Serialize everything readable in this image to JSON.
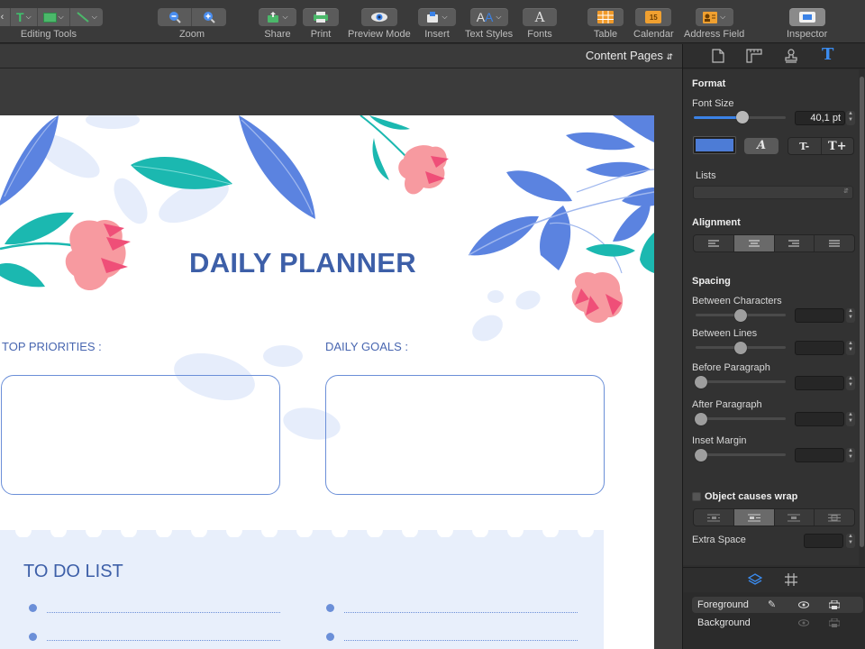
{
  "toolbar": {
    "groups": [
      {
        "label": "Editing Tools"
      },
      {
        "label": "Zoom"
      },
      {
        "label": "Share"
      },
      {
        "label": "Print"
      },
      {
        "label": "Preview Mode"
      },
      {
        "label": "Insert"
      },
      {
        "label": "Text Styles"
      },
      {
        "label": "Fonts"
      },
      {
        "label": "Table"
      },
      {
        "label": "Calendar"
      },
      {
        "label": "Address Field"
      },
      {
        "label": "Inspector"
      }
    ],
    "calendar_day": "15"
  },
  "content_bar": {
    "pages_selector": "Content Pages"
  },
  "document": {
    "title": "DAILY PLANNER",
    "top_priorities_label": "TOP PRIORITIES :",
    "daily_goals_label": "DAILY GOALS :",
    "todo_title": "TO DO LIST"
  },
  "inspector": {
    "format_heading": "Format",
    "font_size_label": "Font Size",
    "font_size_value": "40,1 pt",
    "font_size_slider_level": 0.45,
    "lists_label": "Lists",
    "alignment_heading": "Alignment",
    "spacing_heading": "Spacing",
    "spacing_items": [
      {
        "label": "Between Characters",
        "level": 0.5
      },
      {
        "label": "Between Lines",
        "level": 0.5
      },
      {
        "label": "Before Paragraph",
        "level": 0.0
      },
      {
        "label": "After Paragraph",
        "level": 0.0
      },
      {
        "label": "Inset Margin",
        "level": 0.0
      }
    ],
    "wrap_label": "Object causes wrap",
    "extra_space_label": "Extra Space",
    "text_color": "#4d7cd6",
    "italic_glyph": "A",
    "size_down_glyph": "T-",
    "size_up_glyph": "T+"
  },
  "layers": {
    "foreground": "Foreground",
    "background": "Background"
  },
  "colors": {
    "accent_blue": "#3d5fa8",
    "leaf_blue": "#5b83e0",
    "leaf_teal": "#1bb8b0",
    "flower_pink": "#f79aa0",
    "flower_red": "#ef4f78",
    "todo_bg": "#e8effb"
  }
}
